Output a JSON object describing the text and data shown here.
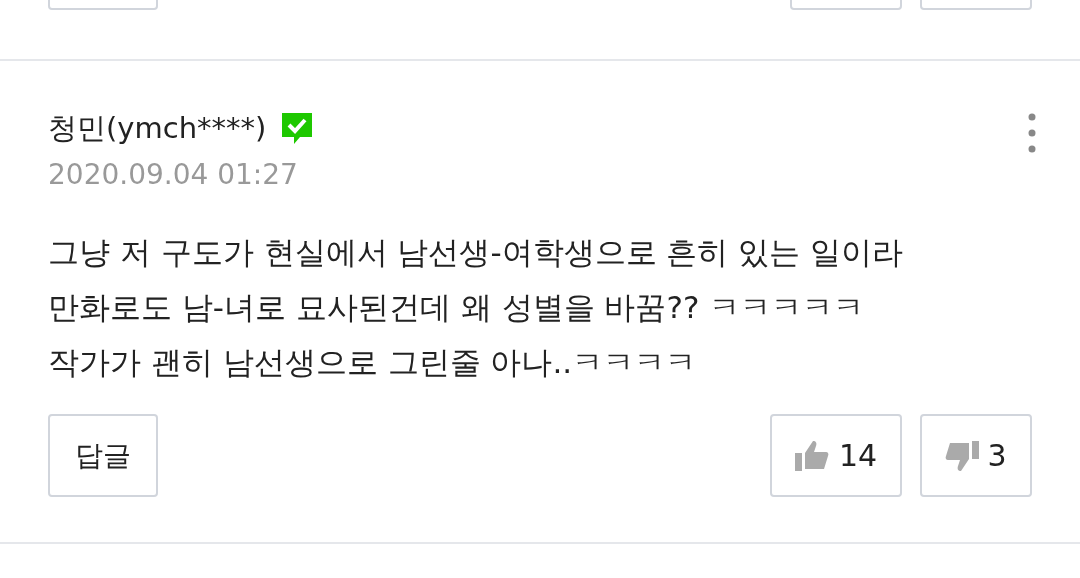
{
  "comment": {
    "author": "청민(ymch****)",
    "verified": true,
    "date": "2020.09.04 01:27",
    "body_lines": [
      "그냥 저 구도가 현실에서 남선생-여학생으로 흔히 있는 일이라",
      "만화로도 남-녀로 묘사된건데 왜 성별을 바꿈?? ㅋㅋㅋㅋㅋ",
      "작가가 괜히 남선생으로 그린줄 아나..ㅋㅋㅋㅋ"
    ],
    "reply_button": "답글",
    "likes": "14",
    "dislikes": "3"
  }
}
